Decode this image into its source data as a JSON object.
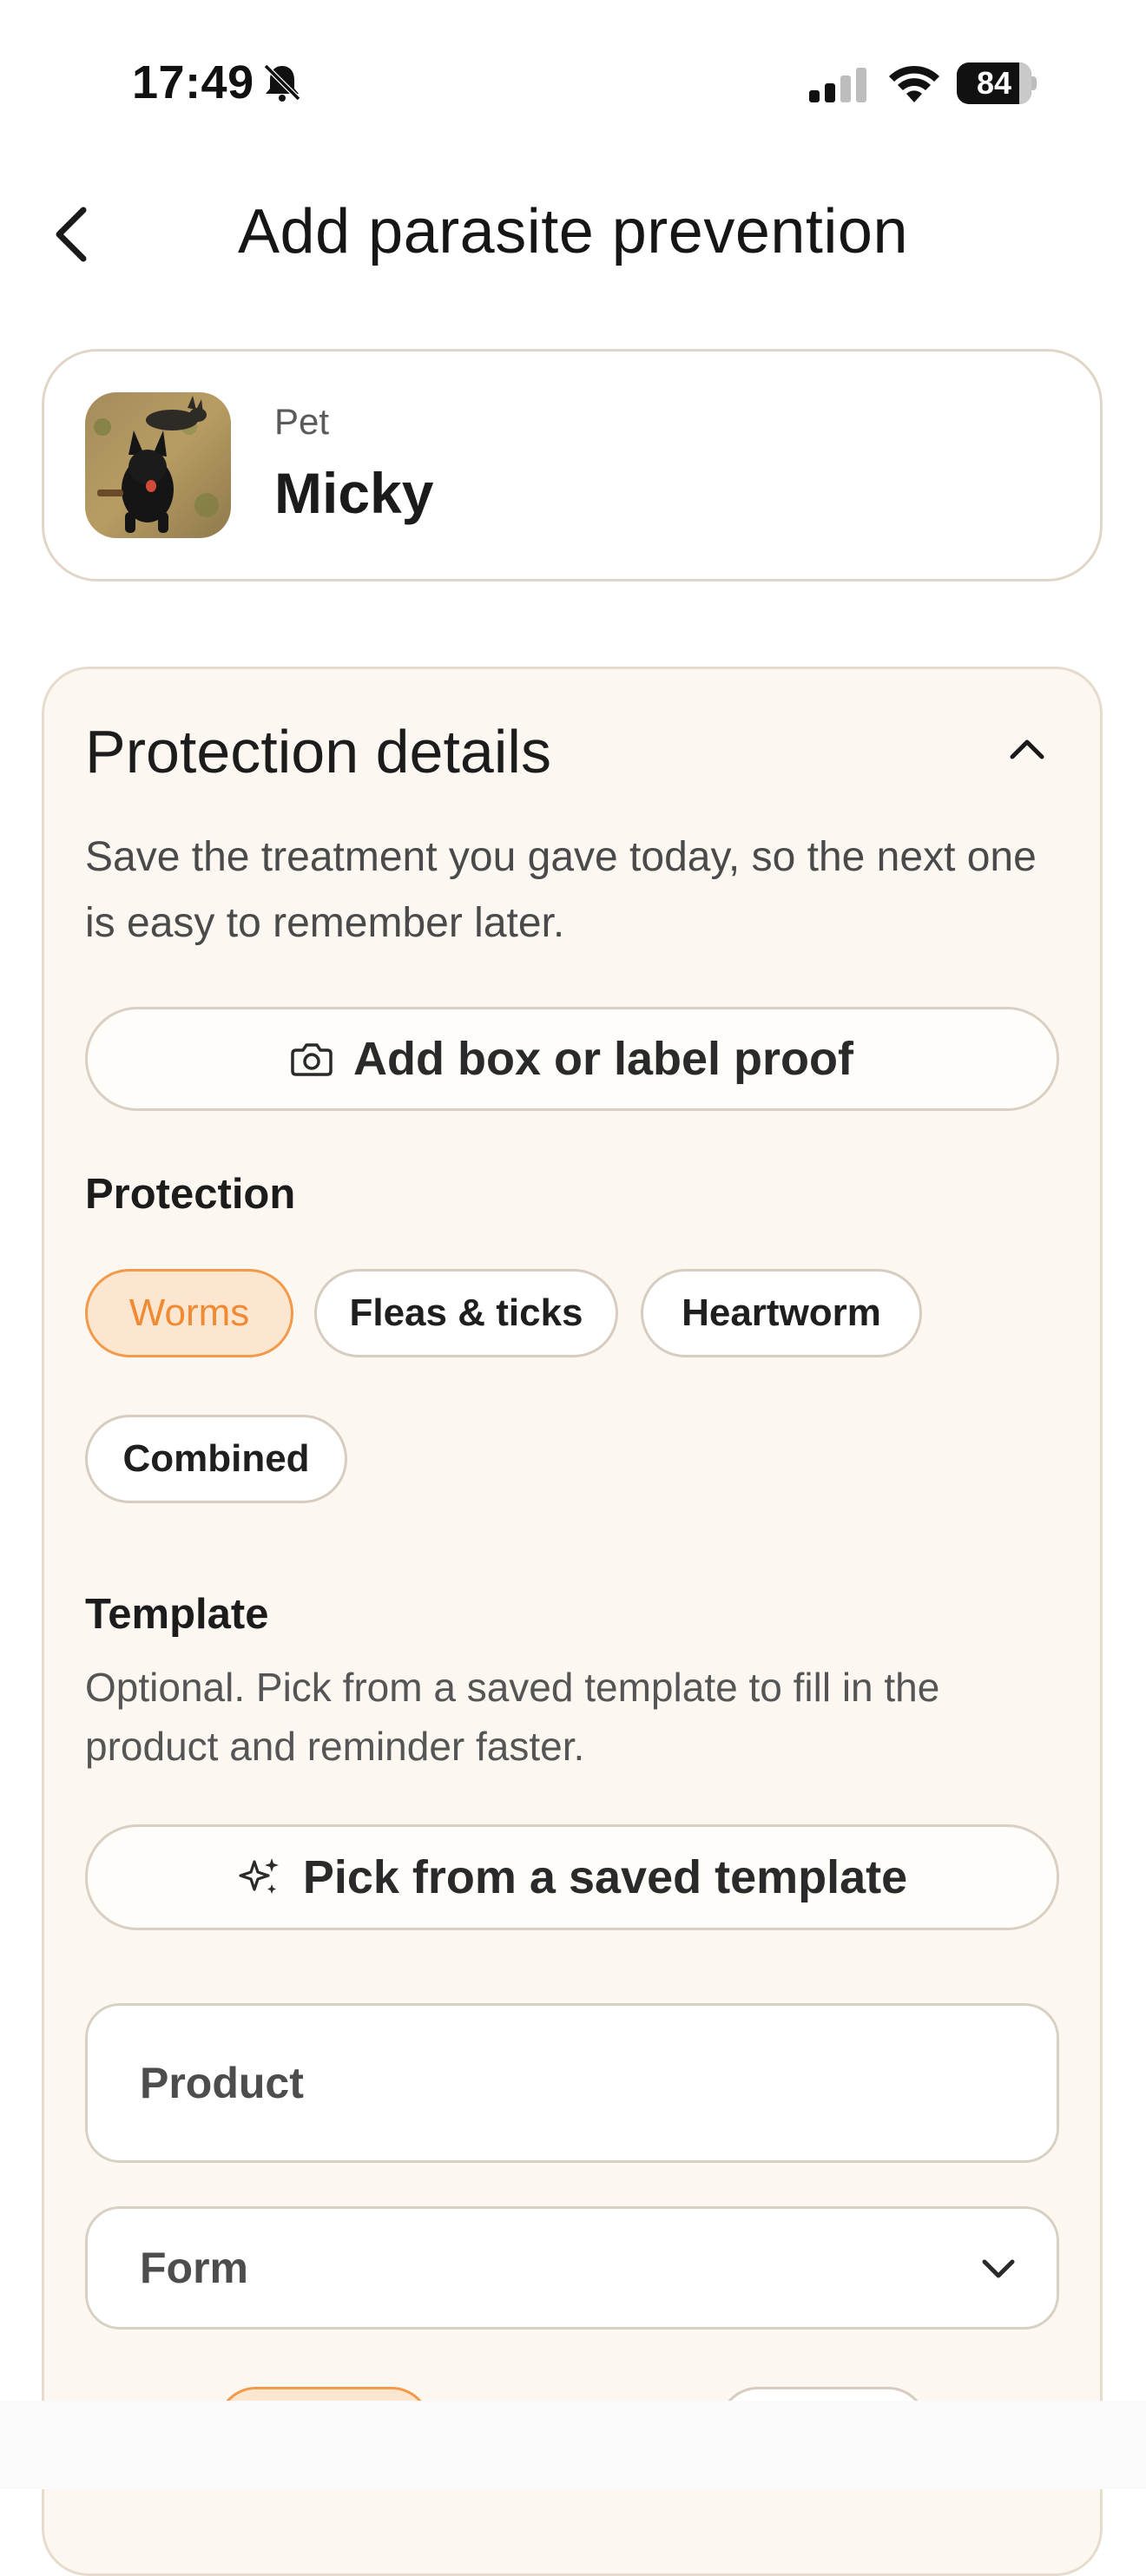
{
  "status_bar": {
    "time": "17:49",
    "battery": "84",
    "battery_level": 0.84,
    "icons": [
      "bell-slash-icon",
      "cellular-signal-icon",
      "wifi-icon",
      "battery-icon"
    ]
  },
  "header": {
    "title": "Add parasite prevention",
    "back_icon": "chevron-left-icon"
  },
  "pet": {
    "label": "Pet",
    "name": "Micky"
  },
  "details": {
    "title": "Protection details",
    "collapse_icon": "chevron-up-icon",
    "description": "Save the treatment you gave today, so the next one is easy to remember later.",
    "proof_button": "Add box or label proof",
    "proof_icon": "camera-icon",
    "protection_label": "Protection",
    "protection_options": [
      {
        "label": "Worms",
        "selected": true
      },
      {
        "label": "Fleas & ticks",
        "selected": false
      },
      {
        "label": "Heartworm",
        "selected": false
      },
      {
        "label": "Combined",
        "selected": false
      }
    ],
    "template_label": "Template",
    "template_description": "Optional. Pick from a saved template to fill in the product and reminder faster.",
    "template_button": "Pick from a saved template",
    "template_icon": "sparkles-icon",
    "product_placeholder": "Product",
    "form_placeholder": "Form",
    "form_icon": "chevron-down-icon"
  },
  "colors": {
    "accent": "#ef8a33",
    "accent_bg": "#fde6cf",
    "card_bg": "#fcf7f1",
    "border": "#d9cfc2"
  }
}
